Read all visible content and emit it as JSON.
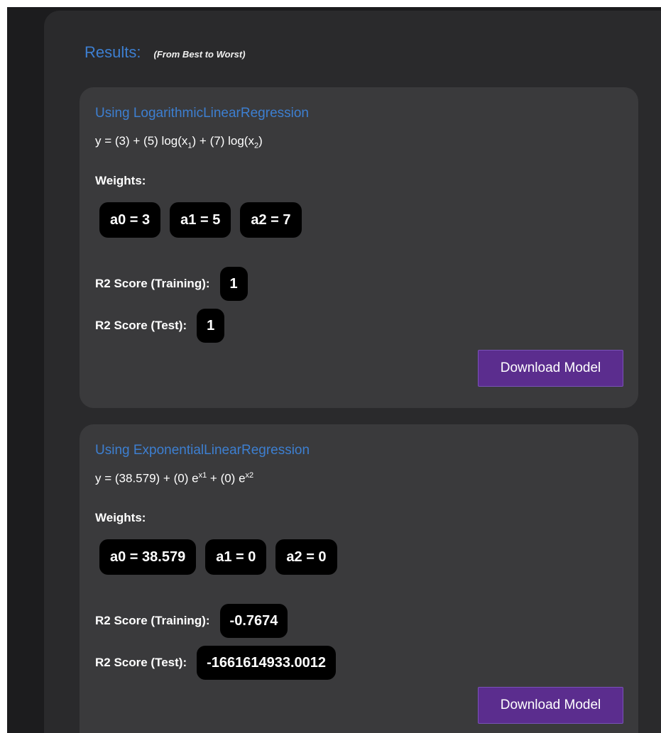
{
  "results": {
    "title": "Results:",
    "subtitle": "(From Best to Worst)"
  },
  "models": [
    {
      "name": "Using LogarithmicLinearRegression",
      "equation": {
        "lhs": "y = ",
        "t0": "(3)",
        "t1_coef": "(5)",
        "t1_fn": "log(x",
        "t1_sub": "1",
        "t1_close": ")",
        "t2_coef": "(7)",
        "t2_fn": "log(x",
        "t2_sub": "2",
        "t2_close": ")",
        "plus": " + "
      },
      "weights_label": "Weights:",
      "weights": [
        "a0 = 3",
        "a1 = 5",
        "a2 = 7"
      ],
      "train_label": "R2 Score (Training):",
      "train_value": "1",
      "test_label": "R2 Score (Test):",
      "test_value": "1",
      "download_label": "Download Model"
    },
    {
      "name": "Using ExponentialLinearRegression",
      "equation": {
        "lhs": "y = ",
        "t0": "(38.579)",
        "t1_coef": "(0)",
        "t1_base": "e",
        "t1_sup": "x1",
        "t2_coef": "(0)",
        "t2_base": "e",
        "t2_sup": "x2",
        "plus": " + "
      },
      "weights_label": "Weights:",
      "weights": [
        "a0 = 38.579",
        "a1 = 0",
        "a2 = 0"
      ],
      "train_label": "R2 Score (Training):",
      "train_value": "-0.7674",
      "test_label": "R2 Score (Test):",
      "test_value": "-1661614933.0012",
      "download_label": "Download Model"
    }
  ],
  "colors": {
    "accent_blue": "#3d7fd1",
    "button_purple": "#5b2d8e",
    "card_bg": "#3a3a3c",
    "panel_bg": "#2a2a2c",
    "page_bg": "#1c1c1e"
  }
}
